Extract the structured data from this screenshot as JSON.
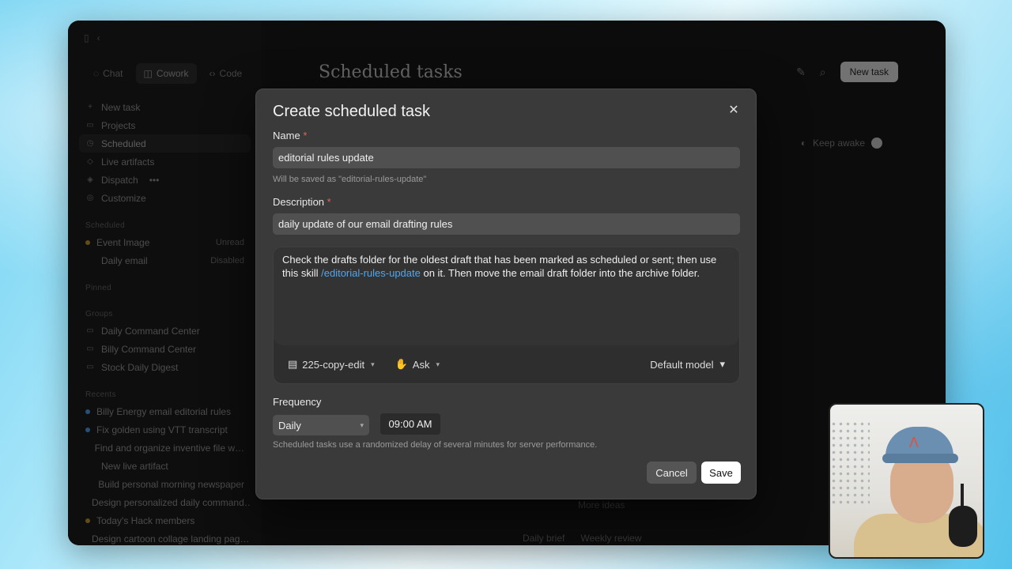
{
  "app": {
    "sidebar": {
      "modes": [
        {
          "label": "Chat",
          "icon": "chat-icon"
        },
        {
          "label": "Cowork",
          "icon": "cowork-icon"
        },
        {
          "label": "Code",
          "icon": "code-icon"
        }
      ],
      "nav": [
        {
          "label": "New task",
          "icon": "plus-icon"
        },
        {
          "label": "Projects",
          "icon": "folder-icon"
        },
        {
          "label": "Scheduled",
          "icon": "clock-icon"
        },
        {
          "label": "Live artifacts",
          "icon": "artifact-icon"
        },
        {
          "label": "Dispatch",
          "icon": "dispatch-icon",
          "badge": "•••"
        },
        {
          "label": "Customize",
          "icon": "customize-icon"
        }
      ],
      "section_1": "Scheduled",
      "scheduled_items": [
        {
          "label": "Event Image",
          "sub": "Unread"
        },
        {
          "label": "Daily email",
          "sub": "Disabled"
        }
      ],
      "section_2": "Pinned",
      "section_3": "Groups",
      "group_items": [
        {
          "label": "Daily Command Center"
        },
        {
          "label": "Billy Command Center"
        },
        {
          "label": "Stock Daily Digest"
        }
      ],
      "section_4": "Recents",
      "recent_items": [
        {
          "label": "Billy Energy email editorial rules",
          "dot": "blue"
        },
        {
          "label": "Fix golden using VTT transcript",
          "dot": "blue"
        },
        {
          "label": "Find and organize inventive file w…",
          "dot": ""
        },
        {
          "label": "New live artifact",
          "dot": ""
        },
        {
          "label": "Build personal morning newspaper",
          "dot": ""
        },
        {
          "label": "Design personalized daily command…",
          "dot": "amber"
        },
        {
          "label": "Today's Hack members",
          "dot": "amber"
        },
        {
          "label": "Design cartoon collage landing pag…",
          "dot": "amber"
        }
      ]
    },
    "main": {
      "title": "Scheduled tasks",
      "new_task_label": "New task",
      "keep_awake_label": "Keep awake",
      "more_ideas": "More ideas",
      "chips": [
        "Daily brief",
        "Weekly review"
      ]
    }
  },
  "modal": {
    "title": "Create scheduled task",
    "close_icon": "close-icon",
    "name_label": "Name",
    "required_mark": "*",
    "name_value": "editorial rules update",
    "name_hint": "Will be saved as \"editorial-rules-update\"",
    "description_label": "Description",
    "description_value": "daily update of our email drafting rules",
    "prompt_before": "Check the drafts folder for the oldest draft that has been marked as scheduled or sent; then use this skill ",
    "prompt_skill": "/editorial-rules-update",
    "prompt_after": " on it.  Then move the email draft folder into the archive folder.",
    "toolbar": {
      "folder_label": "225-copy-edit",
      "permission_label": "Ask",
      "model_label": "Default model"
    },
    "frequency_label": "Frequency",
    "frequency_value": "Daily",
    "time_value": "09:00 AM",
    "frequency_hint": "Scheduled tasks use a randomized delay of several minutes for server performance.",
    "cancel_label": "Cancel",
    "save_label": "Save"
  }
}
